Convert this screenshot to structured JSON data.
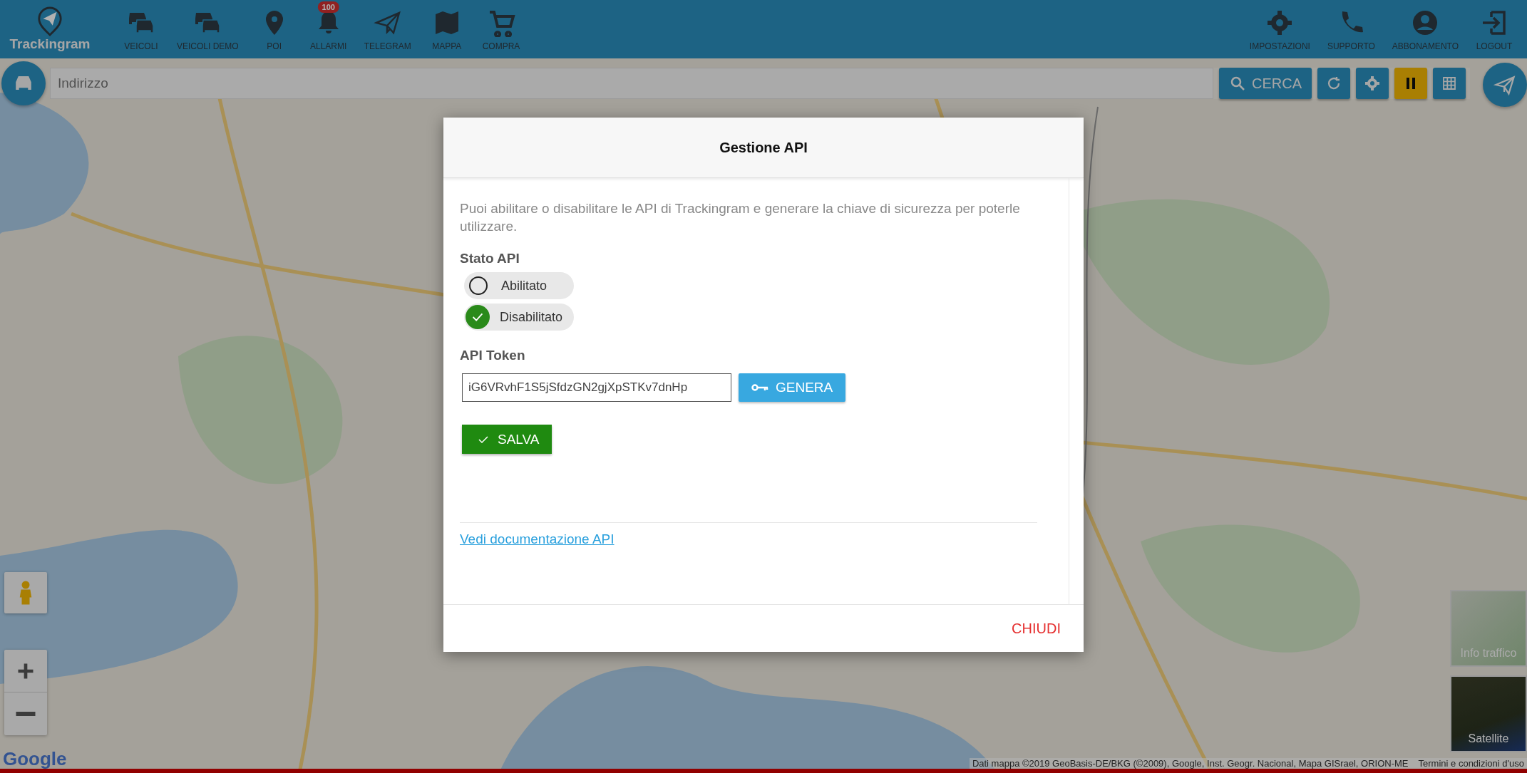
{
  "brand": {
    "name": "Trackingram"
  },
  "nav_left": [
    {
      "label": "VEICOLI",
      "kind": "cars"
    },
    {
      "label": "VEICOLI DEMO",
      "kind": "cars"
    },
    {
      "label": "POI",
      "kind": "pin"
    },
    {
      "label": "ALLARMI",
      "kind": "bell",
      "badge": "100"
    },
    {
      "label": "TELEGRAM",
      "kind": "plane"
    },
    {
      "label": "MAPPA",
      "kind": "map"
    },
    {
      "label": "COMPRA",
      "kind": "cart"
    }
  ],
  "nav_right": [
    {
      "label": "IMPOSTAZIONI",
      "kind": "gear"
    },
    {
      "label": "SUPPORTO",
      "kind": "phone"
    },
    {
      "label": "ABBONAMENTO",
      "kind": "user"
    },
    {
      "label": "LOGOUT",
      "kind": "logout"
    }
  ],
  "search": {
    "placeholder": "Indirizzo",
    "button": "CERCA"
  },
  "toolbar": [
    {
      "kind": "refresh",
      "on": false
    },
    {
      "kind": "gear",
      "on": false
    },
    {
      "kind": "pause",
      "on": true
    },
    {
      "kind": "grid",
      "on": false
    }
  ],
  "map_types": [
    {
      "label": "Info traffico",
      "kind": "traffic"
    },
    {
      "label": "Satellite",
      "kind": "satellite"
    }
  ],
  "map_footer": {
    "logo": "Google",
    "attribution": "Dati mappa ©2019 GeoBasis-DE/BKG (©2009), Google, Inst. Geogr. Nacional, Mapa GISrael, ORION-ME",
    "terms": "Termini e condizioni d'uso"
  },
  "modal": {
    "title": "Gestione API",
    "description": "Puoi abilitare o disabilitare le API di Trackingram e generare la chiave di sicurezza per poterle utilizzare.",
    "status_label": "Stato API",
    "options": [
      {
        "label": "Abilitato",
        "selected": false
      },
      {
        "label": "Disabilitato",
        "selected": true
      }
    ],
    "token_label": "API Token",
    "token_value": "iG6VRvhF1S5jSfdzGN2gjXpSTKv7dnHp",
    "generate": "GENERA",
    "save": "SALVA",
    "link": "Vedi documentazione API",
    "close": "CHIUDI"
  }
}
